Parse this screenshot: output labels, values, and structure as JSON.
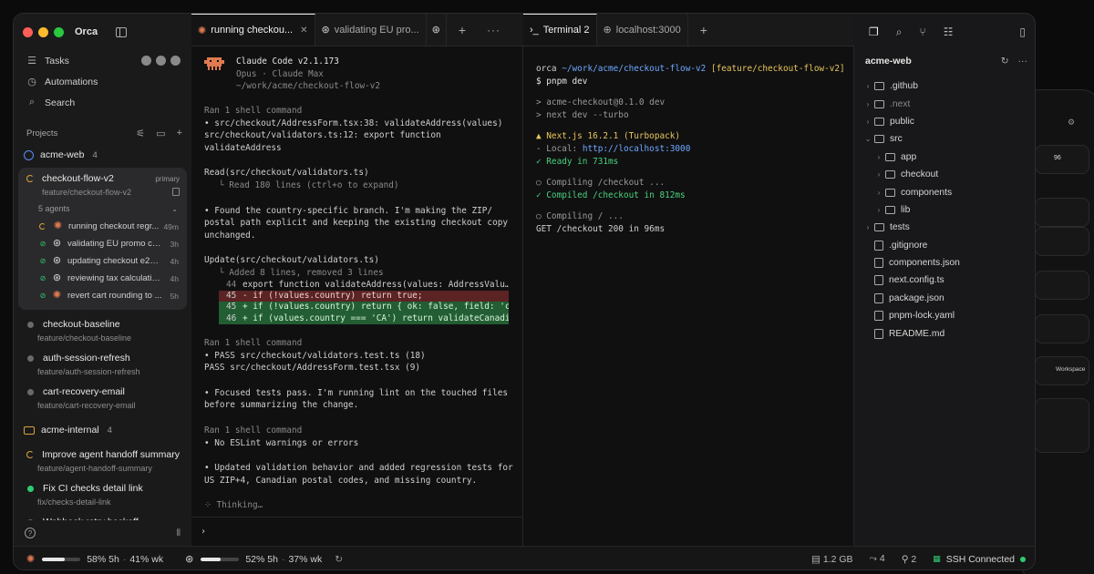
{
  "app": {
    "name": "Orca"
  },
  "sidebar": {
    "nav": [
      {
        "label": "Tasks",
        "icon": "tasks-icon"
      },
      {
        "label": "Automations",
        "icon": "automations-icon"
      },
      {
        "label": "Search",
        "icon": "search-icon"
      }
    ],
    "projects_label": "Projects",
    "repos": [
      {
        "name": "acme-web",
        "count": "4",
        "active_worktree": {
          "title": "checkout-flow-v2",
          "badge": "primary",
          "branch": "feature/checkout-flow-v2",
          "agents_label": "5 agents",
          "agents": [
            {
              "name": "running checkout regr...",
              "time": "49m",
              "status": "running",
              "avatar": "claude"
            },
            {
              "name": "validating EU promo co...",
              "time": "3h",
              "status": "done",
              "avatar": "gpt"
            },
            {
              "name": "updating checkout e2e ...",
              "time": "4h",
              "status": "done",
              "avatar": "gpt"
            },
            {
              "name": "reviewing tax calculatio...",
              "time": "4h",
              "status": "done",
              "avatar": "gpt"
            },
            {
              "name": "revert cart rounding to ...",
              "time": "5h",
              "status": "done",
              "avatar": "claude"
            }
          ]
        },
        "worktrees": [
          {
            "title": "checkout-baseline",
            "branch": "feature/checkout-baseline"
          },
          {
            "title": "auth-session-refresh",
            "branch": "feature/auth-session-refresh"
          },
          {
            "title": "cart-recovery-email",
            "branch": "feature/cart-recovery-email"
          }
        ]
      },
      {
        "name": "acme-internal",
        "count": "4",
        "worktrees": [
          {
            "title": "Improve agent handoff summary",
            "branch": "feature/agent-handoff-summary",
            "state": "running"
          },
          {
            "title": "Fix CI checks detail link",
            "branch": "fix/checks-detail-link",
            "state": "green"
          },
          {
            "title": "Webhook retry backoff",
            "branch": "",
            "state": "idle"
          }
        ]
      }
    ]
  },
  "agent_pane": {
    "tabs": [
      {
        "label": "running checkou...",
        "icon": "claude",
        "active": true
      },
      {
        "label": "validating EU pro...",
        "icon": "gpt",
        "active": false
      },
      {
        "label": "",
        "icon": "gpt",
        "active": false
      }
    ],
    "header": {
      "title": "Claude Code v2.1.173",
      "model": "Opus · Claude Max",
      "path": "~/work/acme/checkout-flow-v2"
    },
    "ran1": "Ran 1 shell command",
    "ran1_a": "• src/checkout/AddressForm.tsx:38: validateAddress(values)",
    "ran1_b": "src/checkout/validators.ts:12: export function",
    "ran1_c": "validateAddress",
    "read": "Read(src/checkout/validators.ts)",
    "read_sub": "└ Read 180 lines (ctrl+o to expand)",
    "found_a": "• Found the country-specific branch. I'm making the ZIP/",
    "found_b": "postal path explicit and keeping the existing checkout copy",
    "found_c": "unchanged.",
    "update": "Update(src/checkout/validators.ts)",
    "update_sub": "└ Added 8 lines, removed 3 lines",
    "diff": [
      {
        "n": "44",
        "t": "export function validateAddress(values: AddressValu…",
        "k": "ctx"
      },
      {
        "n": "45",
        "t": "- if (!values.country) return true;",
        "k": "del"
      },
      {
        "n": "45",
        "t": "+ if (!values.country) return { ok: false, field: 'co…",
        "k": "add"
      },
      {
        "n": "46",
        "t": "+ if (values.country === 'CA') return validateCanadia…",
        "k": "add"
      }
    ],
    "ran2": "Ran 1 shell command",
    "ran2_a": "• PASS src/checkout/validators.test.ts (18)",
    "ran2_b": "PASS src/checkout/AddressForm.test.tsx (9)",
    "focused_a": "• Focused tests pass. I'm running lint on the touched files",
    "focused_b": "before summarizing the change.",
    "ran3": "Ran 1 shell command",
    "ran3_a": "• No ESLint warnings or errors",
    "updated_a": "• Updated validation behavior and added regression tests for",
    "updated_b": "US ZIP+4, Canadian postal codes, and missing country.",
    "thinking": "⁘ Thinking…",
    "prompt": "›"
  },
  "terminal_pane": {
    "tabs": [
      {
        "label": "Terminal 2",
        "active": true
      },
      {
        "label": "localhost:3000",
        "active": false
      }
    ],
    "prompt_user": "orca",
    "prompt_path": "~/work/acme/checkout-flow-v2",
    "prompt_branch": "[feature/checkout-flow-v2]",
    "cmd": "$ pnpm dev",
    "l1": "> acme-checkout@0.1.0 dev",
    "l2": "> next dev --turbo",
    "next_ver": "▲  Next.js 16.2.1 (Turbopack)",
    "local_label": "- Local:",
    "local_url": "http://localhost:3000",
    "ready": "✓ Ready in 731ms",
    "compiling1": "○ Compiling /checkout ...",
    "compiled": "✓ Compiled /checkout in 812ms",
    "compiling2": "○ Compiling / ...",
    "get": "GET /checkout 200 in 96ms"
  },
  "files_pane": {
    "root": "acme-web",
    "items": [
      {
        "name": ".github",
        "type": "folder",
        "depth": 0,
        "open": false
      },
      {
        "name": ".next",
        "type": "folder",
        "depth": 0,
        "open": false,
        "muted": true
      },
      {
        "name": "public",
        "type": "folder",
        "depth": 0,
        "open": false
      },
      {
        "name": "src",
        "type": "folder",
        "depth": 0,
        "open": true
      },
      {
        "name": "app",
        "type": "folder",
        "depth": 1,
        "open": false
      },
      {
        "name": "checkout",
        "type": "folder",
        "depth": 1,
        "open": false
      },
      {
        "name": "components",
        "type": "folder",
        "depth": 1,
        "open": false
      },
      {
        "name": "lib",
        "type": "folder",
        "depth": 1,
        "open": false
      },
      {
        "name": "tests",
        "type": "folder",
        "depth": 0,
        "open": false
      },
      {
        "name": ".gitignore",
        "type": "file",
        "depth": 0
      },
      {
        "name": "components.json",
        "type": "file",
        "depth": 0
      },
      {
        "name": "next.config.ts",
        "type": "file",
        "depth": 0
      },
      {
        "name": "package.json",
        "type": "file",
        "depth": 0
      },
      {
        "name": "pnpm-lock.yaml",
        "type": "file",
        "depth": 0
      },
      {
        "name": "README.md",
        "type": "file",
        "depth": 0
      }
    ]
  },
  "statusbar": {
    "claude_usage": {
      "text_5h": "58% 5h",
      "text_wk": "41% wk",
      "level": 0.58
    },
    "gpt_usage": {
      "text_5h": "52% 5h",
      "text_wk": "37% wk",
      "level": 0.52
    },
    "memory": "1.2 GB",
    "agents_count": "4",
    "ports_count": "2",
    "ssh": "SSH Connected"
  },
  "background_device": {
    "items": [
      "96",
      "Workspace"
    ]
  }
}
